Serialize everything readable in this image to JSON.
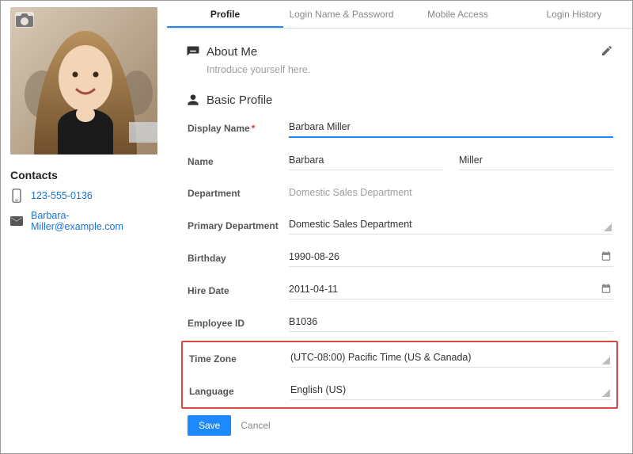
{
  "sidebar": {
    "contacts_title": "Contacts",
    "phone": "123-555-0136",
    "email": "Barbara-Miller@example.com"
  },
  "tabs": [
    {
      "label": "Profile",
      "active": true
    },
    {
      "label": "Login Name & Password",
      "active": false
    },
    {
      "label": "Mobile Access",
      "active": false
    },
    {
      "label": "Login History",
      "active": false
    }
  ],
  "about": {
    "title": "About Me",
    "placeholder": "Introduce yourself here."
  },
  "profile": {
    "title": "Basic Profile",
    "display_name_label": "Display Name",
    "display_name": "Barbara Miller",
    "name_label": "Name",
    "first_name": "Barbara",
    "last_name": "Miller",
    "department_label": "Department",
    "department": "Domestic Sales Department",
    "primary_dept_label": "Primary Department",
    "primary_dept": "Domestic Sales Department",
    "birthday_label": "Birthday",
    "birthday": "1990-08-26",
    "hire_label": "Hire Date",
    "hire_date": "2011-04-11",
    "employee_id_label": "Employee ID",
    "employee_id": "B1036",
    "timezone_label": "Time Zone",
    "timezone": "(UTC-08:00) Pacific Time (US & Canada)",
    "language_label": "Language",
    "language": "English (US)"
  },
  "actions": {
    "save": "Save",
    "cancel": "Cancel"
  }
}
